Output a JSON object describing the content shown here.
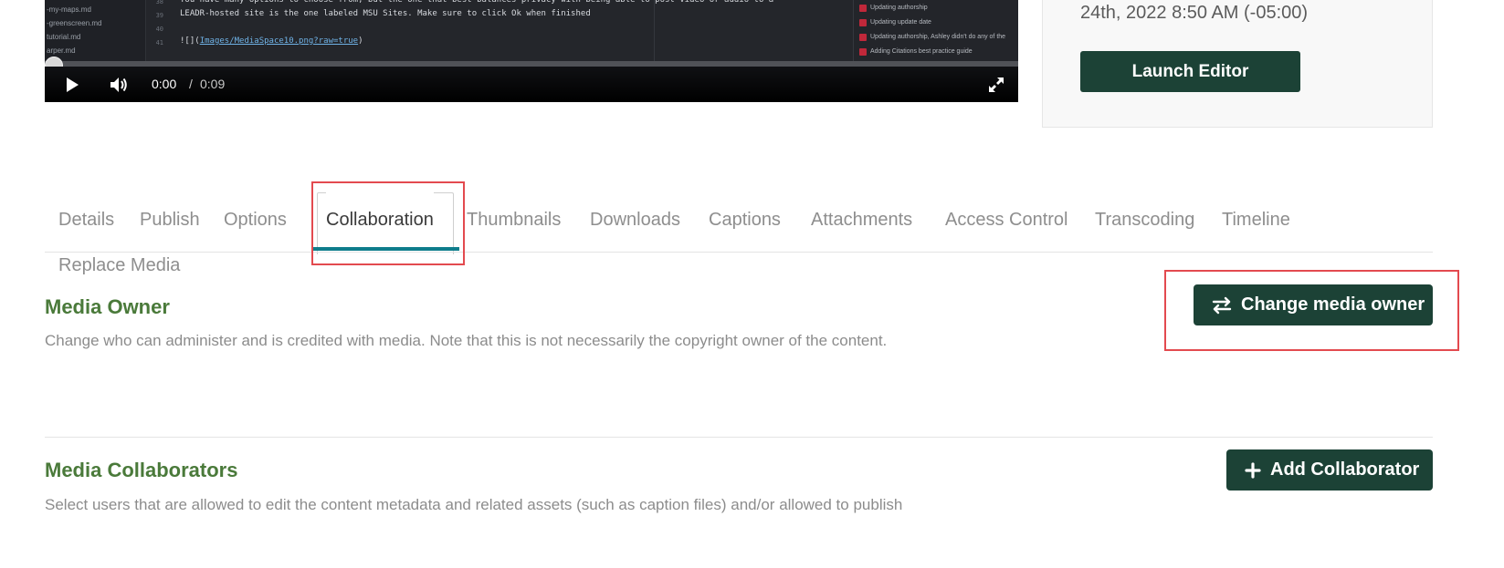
{
  "player": {
    "file_tree": [
      "-my-maps.md",
      "-greenscreen.md",
      "tutorial.md",
      "arper.md"
    ],
    "line_numbers": [
      "38",
      "39",
      "40",
      "41"
    ],
    "code_lines": [
      "You have many options to choose from, but the one that best balances privacy with being able to post video or audio to a",
      "LEADR-hosted site is the one labeled MSU Sites. Make sure to click Ok when finished",
      "",
      "![](Images/MediaSpace10.png?raw=true)"
    ],
    "commits": [
      "Updating authorship",
      "Updating update date",
      "Updating authorship, Ashley didn't do any of the",
      "Adding Citations best practice guide"
    ],
    "current_time": "0:00",
    "separator": "/",
    "duration": "0:09",
    "progress": 0.0,
    "icons": {
      "play": "play-icon",
      "volume": "volume-icon",
      "fullscreen": "fullscreen-icon"
    }
  },
  "side_card": {
    "date_text": "24th, 2022 8:50 AM (-05:00)",
    "launch_editor_label": "Launch Editor"
  },
  "tabs": {
    "items": [
      "Details",
      "Publish",
      "Options",
      "Collaboration",
      "Thumbnails",
      "Downloads",
      "Captions",
      "Attachments",
      "Access Control",
      "Transcoding",
      "Timeline"
    ],
    "second_row": "Replace Media",
    "active": "Collaboration",
    "accent_color": "#0e7d8c"
  },
  "media_owner": {
    "title": "Media Owner",
    "description": "Change who can administer and is credited with media. Note that this is not necessarily the copyright owner of the content.",
    "button_label": "Change media owner",
    "button_icon": "swap-arrows-icon"
  },
  "media_collaborators": {
    "title": "Media Collaborators",
    "description": "Select users that are allowed to edit the content metadata and related assets (such as caption files) and/or allowed to publish",
    "button_label": "Add Collaborator",
    "button_icon": "plus-icon"
  },
  "colors": {
    "primary_button": "#1c4236",
    "section_title": "#4a7a3a",
    "annotation": "#e34a4f"
  }
}
